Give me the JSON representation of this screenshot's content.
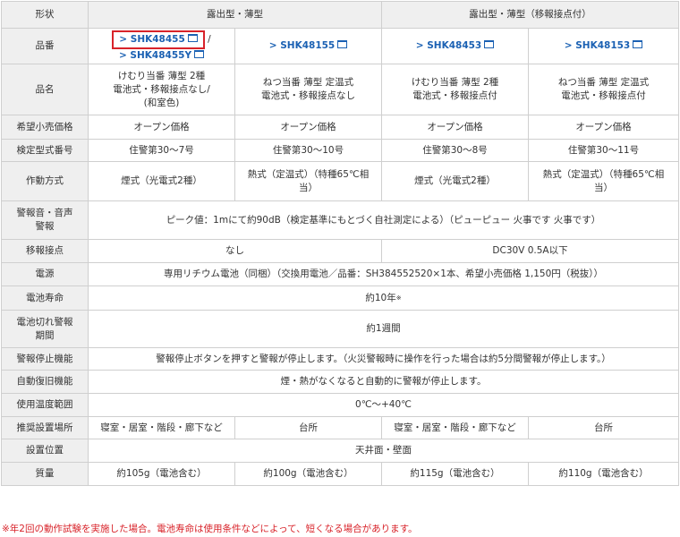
{
  "header": {
    "label": "形状",
    "type_a": "露出型・薄型",
    "type_b": "露出型・薄型（移報接点付）"
  },
  "models": {
    "label": "品番",
    "m1": "SHK48455",
    "m1_sep": "/",
    "m1_alt": "SHK48455Y",
    "m2": "SHK48155",
    "m3": "SHK48453",
    "m4": "SHK48153",
    "arrow": ">"
  },
  "name": {
    "label": "品名",
    "m1_l1": "けむり当番 薄型 2種",
    "m1_l2": "電池式・移報接点なし/",
    "m1_l3": "(和室色)",
    "m2_l1": "ねつ当番 薄型 定温式",
    "m2_l2": "電池式・移報接点なし",
    "m3_l1": "けむり当番 薄型 2種",
    "m3_l2": "電池式・移報接点付",
    "m4_l1": "ねつ当番 薄型 定温式",
    "m4_l2": "電池式・移報接点付"
  },
  "price": {
    "label": "希望小売価格",
    "value": "オープン価格"
  },
  "cert": {
    "label": "検定型式番号",
    "m1": "住警第30～7号",
    "m2": "住警第30～10号",
    "m3": "住警第30～8号",
    "m4": "住警第30～11号"
  },
  "method": {
    "label": "作動方式",
    "smoke": "煙式（光電式2種）",
    "heat_l1": "熱式（定温式）（特種65℃相",
    "heat_l2": "当）"
  },
  "alarm": {
    "label_l1": "警報音・音声",
    "label_l2": "警報",
    "value": "ピーク値：1mにて約90dB（検定基準にもとづく自社測定による）（ピューピュー 火事です 火事です）"
  },
  "relay": {
    "label": "移報接点",
    "none": "なし",
    "rating": "DC30V 0.5A以下"
  },
  "power": {
    "label": "電源",
    "value": "専用リチウム電池（同梱）（交換用電池／品番：SH384552520×1本、希望小売価格 1,150円（税抜））"
  },
  "battery_life": {
    "label": "電池寿命",
    "value": "約10年",
    "mark": "※"
  },
  "low_battery": {
    "label_l1": "電池切れ警報",
    "label_l2": "期間",
    "value": "約1週間"
  },
  "stop": {
    "label": "警報停止機能",
    "value": "警報停止ボタンを押すと警報が停止します。（火災警報時に操作を行った場合は約5分間警報が停止します。）"
  },
  "auto_reset": {
    "label": "自動復旧機能",
    "value": "煙・熱がなくなると自動的に警報が停止します。"
  },
  "temp": {
    "label": "使用温度範囲",
    "value": "0℃～+40℃"
  },
  "location": {
    "label": "推奨設置場所",
    "rooms": "寝室・居室・階段・廊下など",
    "kitchen": "台所"
  },
  "mount": {
    "label": "設置位置",
    "value": "天井面・壁面"
  },
  "weight": {
    "label": "質量",
    "m1": "約105g（電池含む）",
    "m2": "約100g（電池含む）",
    "m3": "約115g（電池含む）",
    "m4": "約110g（電池含む）"
  },
  "footnote": "※年2回の動作試験を実施した場合。電池寿命は使用条件などによって、短くなる場合があります。",
  "colors": {
    "link": "#1b61b3",
    "highlight": "#d8232a",
    "header_bg": "#efefef",
    "border": "#cfcfcf"
  }
}
